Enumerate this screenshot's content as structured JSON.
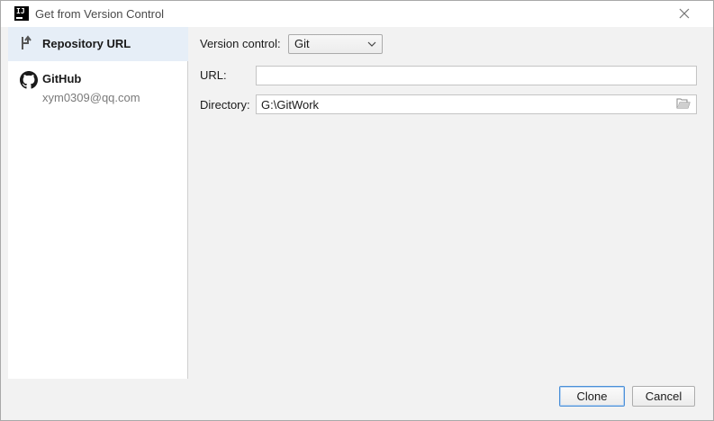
{
  "window": {
    "title": "Get from Version Control",
    "app_icon_text": "IJ"
  },
  "sidebar": {
    "items": [
      {
        "label": "Repository URL",
        "icon": "repository-url-icon",
        "selected": true
      },
      {
        "label": "GitHub",
        "sublabel": "xym0309@qq.com",
        "icon": "github-icon",
        "selected": false
      }
    ]
  },
  "form": {
    "version_control_label": "Version control:",
    "version_control_value": "Git",
    "url_label": "URL:",
    "url_value": "",
    "directory_label": "Directory:",
    "directory_value": "G:\\GitWork"
  },
  "buttons": {
    "clone": "Clone",
    "cancel": "Cancel"
  },
  "colors": {
    "selected_bg": "#e6eef7",
    "default_button_border": "#4a8fd8",
    "dialog_bg": "#f2f2f2"
  }
}
